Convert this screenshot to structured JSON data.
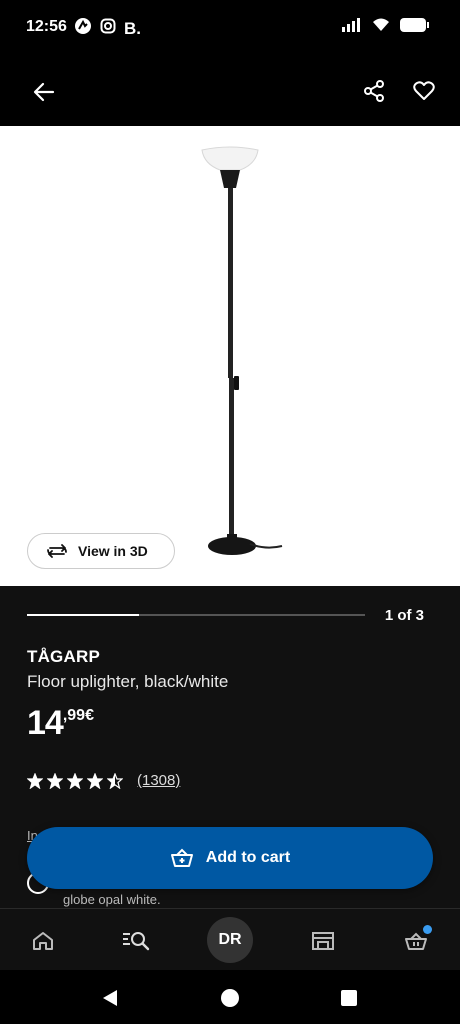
{
  "status_bar": {
    "time": "12:56",
    "b_label": "B.",
    "icons": [
      "app-logo-icon",
      "instagram-icon",
      "signal-icon",
      "wifi-icon",
      "battery-icon"
    ]
  },
  "app_bar": {
    "icons": [
      "arrow-left-icon",
      "share-icon",
      "heart-icon"
    ]
  },
  "media": {
    "view_3d_label": "View in 3D",
    "carousel_label": "1 of 3",
    "carousel_progress": 0.33
  },
  "product": {
    "name": "TÅGARP",
    "description": "Floor uplighter, black/white",
    "price_integer": "14",
    "price_decimal": ",99€",
    "rating": 4.5,
    "rating_count": "(1308)"
  },
  "partial": {
    "link_fragment": "In",
    "info_text": "globe opal white."
  },
  "cta": {
    "add_to_cart_label": "Add to cart",
    "color": "#0058a3"
  },
  "bottom_nav": {
    "items": [
      "home-icon",
      "search-icon",
      "DR",
      "store-icon",
      "cart-icon"
    ],
    "avatar_initials": "DR"
  }
}
